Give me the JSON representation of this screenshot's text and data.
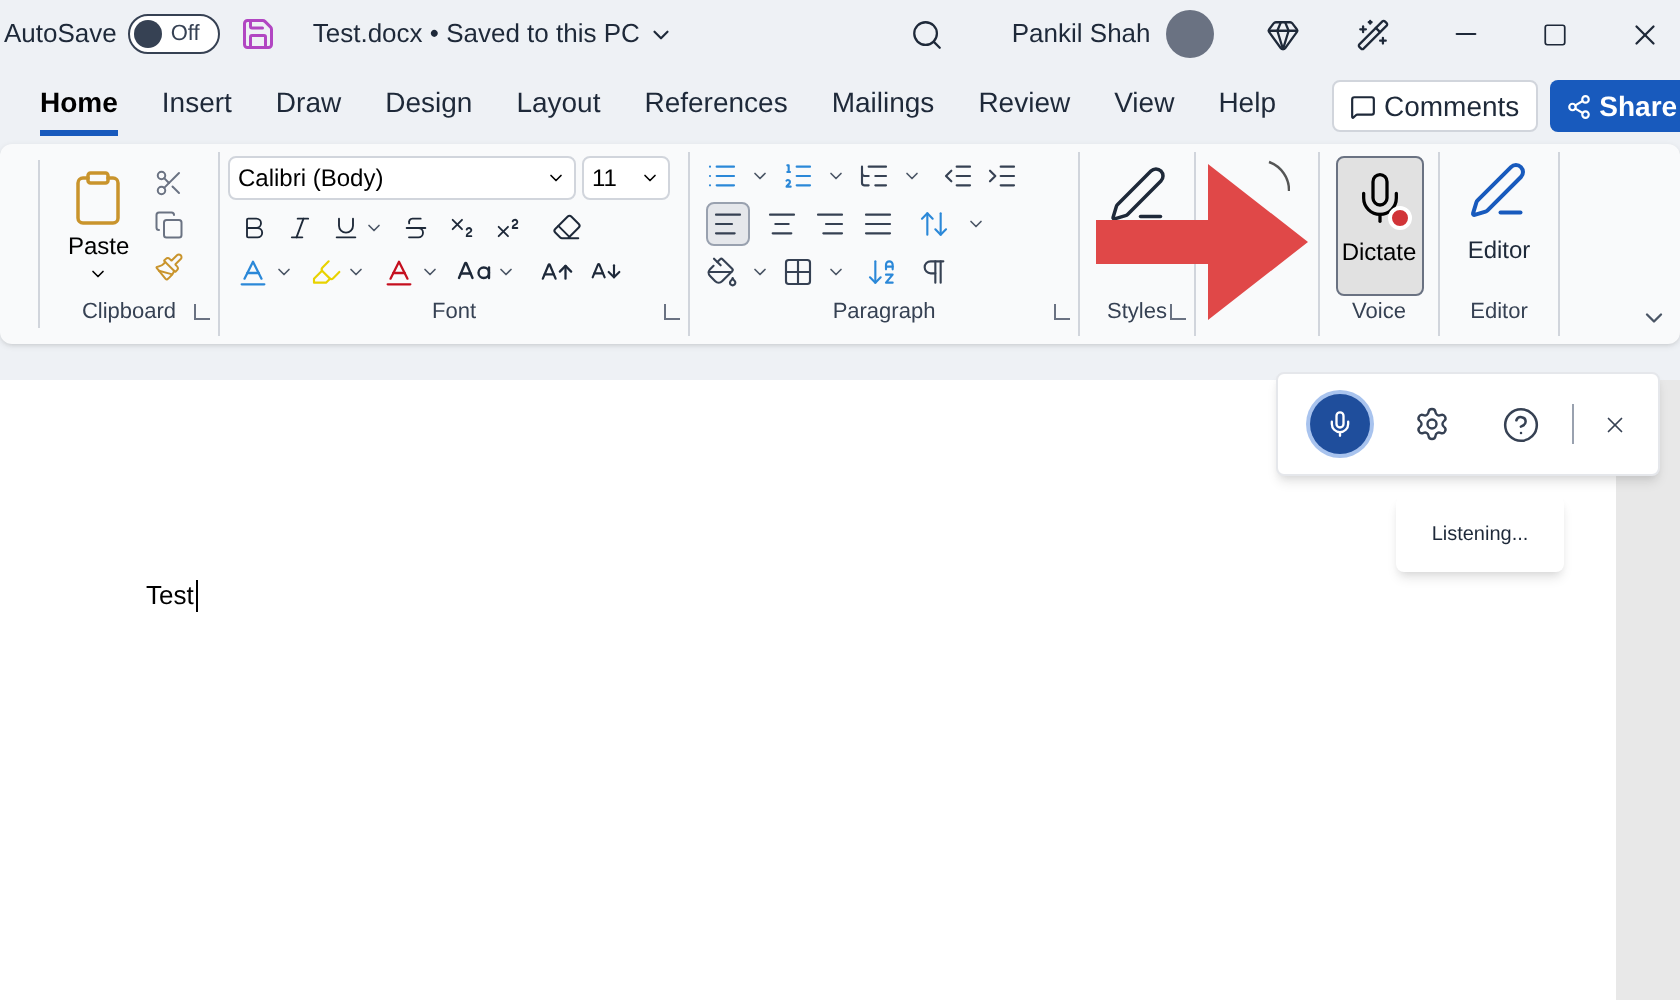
{
  "title_bar": {
    "autosave_label": "AutoSave",
    "autosave_on": false,
    "autosave_state": "Off",
    "document_title": "Test.docx • Saved to this PC",
    "user_name": "Pankil Shah"
  },
  "tabs": [
    {
      "label": "Home",
      "selected": true
    },
    {
      "label": "Insert",
      "selected": false
    },
    {
      "label": "Draw",
      "selected": false
    },
    {
      "label": "Design",
      "selected": false
    },
    {
      "label": "Layout",
      "selected": false
    },
    {
      "label": "References",
      "selected": false
    },
    {
      "label": "Mailings",
      "selected": false
    },
    {
      "label": "Review",
      "selected": false
    },
    {
      "label": "View",
      "selected": false
    },
    {
      "label": "Help",
      "selected": false
    }
  ],
  "comments_button": "Comments",
  "share_button": "Share",
  "ribbon": {
    "paste_label": "Paste",
    "font_name": "Calibri (Body)",
    "font_size": "11",
    "clipboard_label": "Clipboard",
    "font_label": "Font",
    "paragraph_label": "Paragraph",
    "styles_label": "Styles",
    "voice_label": "Voice",
    "dictate": {
      "label": "Dictate",
      "selected": true
    },
    "editor_button": "Editor",
    "editor_label": "Editor",
    "align_left_selected": true
  },
  "document": {
    "text": "Test"
  },
  "dictation_toolbar": {
    "listening": true,
    "tooltip": "Listening..."
  }
}
